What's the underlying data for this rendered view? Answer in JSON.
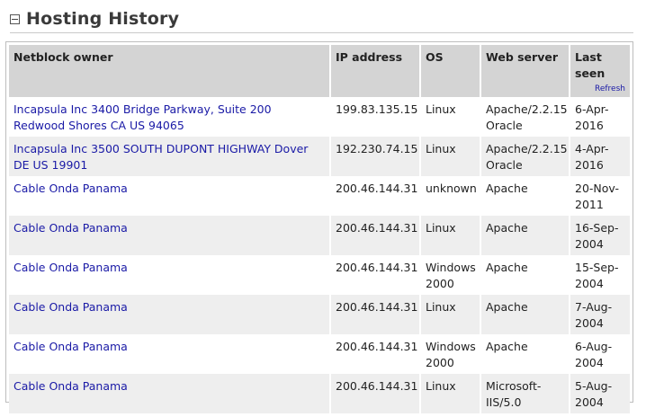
{
  "section": {
    "title": "Hosting History"
  },
  "table": {
    "headers": {
      "owner": "Netblock owner",
      "ip": "IP address",
      "os": "OS",
      "web": "Web server",
      "last_seen": "Last seen",
      "refresh": "Refresh"
    },
    "rows": [
      {
        "owner": "Incapsula Inc 3400 Bridge Parkway, Suite 200 Redwood Shores CA US 94065",
        "ip": "199.83.135.15",
        "os": "Linux",
        "web": "Apache/2.2.15 Oracle",
        "last_seen": "6-Apr-2016"
      },
      {
        "owner": "Incapsula Inc 3500 SOUTH DUPONT HIGHWAY Dover DE US 19901",
        "ip": "192.230.74.15",
        "os": "Linux",
        "web": "Apache/2.2.15 Oracle",
        "last_seen": "4-Apr-2016"
      },
      {
        "owner": "Cable Onda Panama",
        "ip": "200.46.144.31",
        "os": "unknown",
        "web": "Apache",
        "last_seen": "20-Nov-2011"
      },
      {
        "owner": "Cable Onda Panama",
        "ip": "200.46.144.31",
        "os": "Linux",
        "web": "Apache",
        "last_seen": "16-Sep-2004"
      },
      {
        "owner": "Cable Onda Panama",
        "ip": "200.46.144.31",
        "os": "Windows 2000",
        "web": "Apache",
        "last_seen": "15-Sep-2004"
      },
      {
        "owner": "Cable Onda Panama",
        "ip": "200.46.144.31",
        "os": "Linux",
        "web": "Apache",
        "last_seen": "7-Aug-2004"
      },
      {
        "owner": "Cable Onda Panama",
        "ip": "200.46.144.31",
        "os": "Windows 2000",
        "web": "Apache",
        "last_seen": "6-Aug-2004"
      },
      {
        "owner": "Cable Onda Panama",
        "ip": "200.46.144.31",
        "os": "Linux",
        "web": "Microsoft-IIS/5.0",
        "last_seen": "5-Aug-2004"
      }
    ]
  }
}
